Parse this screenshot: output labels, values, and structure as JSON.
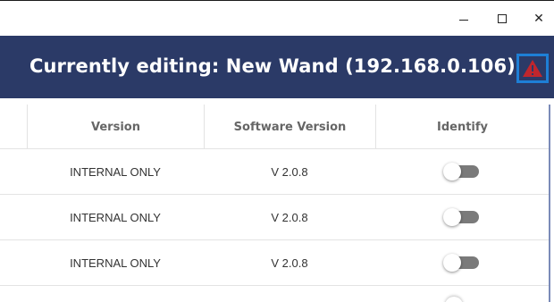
{
  "window": {
    "minimize_glyph": "–",
    "maximize_glyph": "☐",
    "close_glyph": "✕"
  },
  "header": {
    "title": "Currently editing: New Wand (192.168.0.106)",
    "alert_icon": "warning-triangle-icon",
    "background": "#2b3a67",
    "alert_color": "#c0262d",
    "focus_border": "#1e7fd6"
  },
  "table": {
    "columns": [
      "Version",
      "Software Version",
      "Identify"
    ],
    "rows": [
      {
        "version": "INTERNAL ONLY",
        "software_version": "V 2.0.8",
        "identify": false
      },
      {
        "version": "INTERNAL ONLY",
        "software_version": "V 2.0.8",
        "identify": false
      },
      {
        "version": "INTERNAL ONLY",
        "software_version": "V 2.0.8",
        "identify": false
      }
    ]
  }
}
